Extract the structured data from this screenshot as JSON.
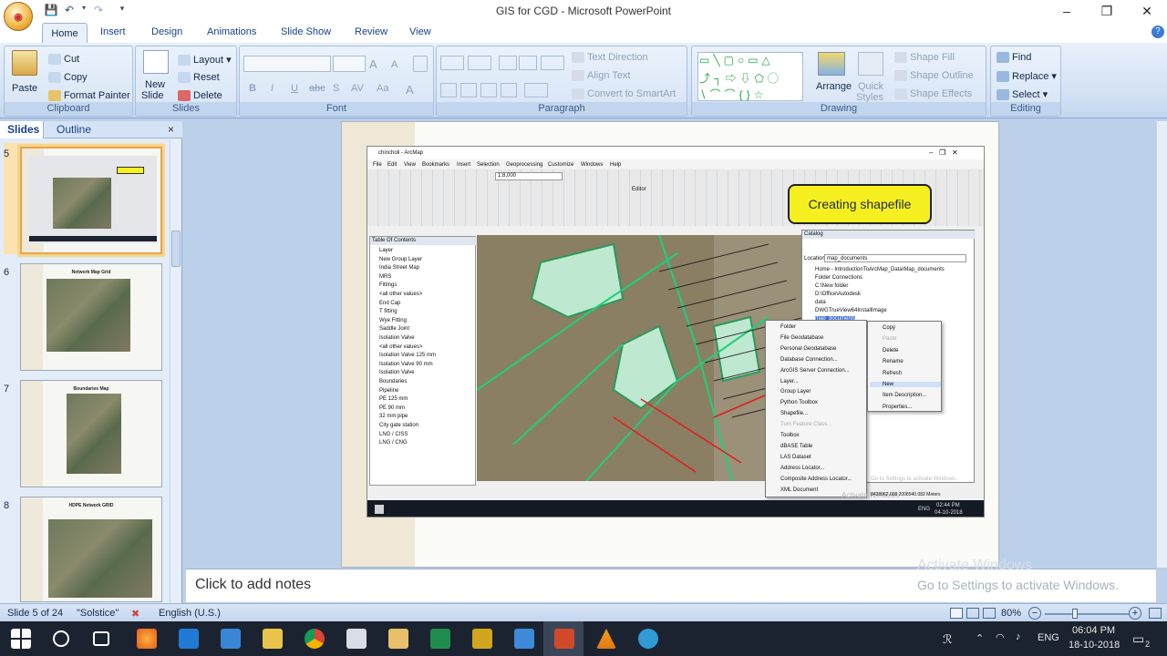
{
  "window": {
    "title": "GIS for CGD - Microsoft PowerPoint",
    "minimize_glyph": "–",
    "maximize_glyph": "❐",
    "close_glyph": "✕",
    "office_button_icon": "office-logo-icon"
  },
  "tabs": [
    "Home",
    "Insert",
    "Design",
    "Animations",
    "Slide Show",
    "Review",
    "View"
  ],
  "ribbon": {
    "clipboard": {
      "label": "Clipboard",
      "paste": "Paste",
      "cut": "Cut",
      "copy": "Copy",
      "format_painter": "Format Painter"
    },
    "slides": {
      "label": "Slides",
      "new_slide_line1": "New",
      "new_slide_line2": "Slide",
      "layout": "Layout",
      "reset": "Reset",
      "delete": "Delete"
    },
    "font": {
      "label": "Font",
      "bold": "B",
      "italic": "I",
      "underline": "U",
      "strike": "abc",
      "shadow": "S",
      "spacing": "AV",
      "case": "Aa",
      "color": "A",
      "grow": "A",
      "shrink": "A"
    },
    "paragraph": {
      "label": "Paragraph",
      "text_direction": "Text Direction",
      "align_text": "Align Text",
      "convert_smartart": "Convert to SmartArt"
    },
    "drawing": {
      "label": "Drawing",
      "arrange": "Arrange",
      "quick_styles_line1": "Quick",
      "quick_styles_line2": "Styles",
      "shape_fill": "Shape Fill",
      "shape_outline": "Shape Outline",
      "shape_effects": "Shape Effects"
    },
    "editing": {
      "label": "Editing",
      "find": "Find",
      "replace": "Replace",
      "select": "Select"
    }
  },
  "slides_pane": {
    "tab_slides": "Slides",
    "tab_outline": "Outline",
    "close_glyph": "×",
    "thumbnails": [
      {
        "number": "5",
        "title": "",
        "selected": true
      },
      {
        "number": "6",
        "title": "Network Map Grid",
        "selected": false
      },
      {
        "number": "7",
        "title": "Boundaries Map",
        "selected": false
      },
      {
        "number": "8",
        "title": "HDPE Network GRID",
        "selected": false
      }
    ]
  },
  "notes": {
    "placeholder": "Click to add notes"
  },
  "watermark": {
    "line1": "Activate Windows",
    "line2": "Go to Settings to activate Windows."
  },
  "status": {
    "slide_info": "Slide 5 of 24",
    "theme": "\"Solstice\"",
    "language": "English (U.S.)",
    "zoom": "80%"
  },
  "callout": {
    "text": "Creating shapefile"
  },
  "inner_arcmap": {
    "title": "chincholi - ArcMap",
    "menus": [
      "File",
      "Edit",
      "View",
      "Bookmarks",
      "Insert",
      "Selection",
      "Geoprocessing",
      "Customize",
      "Windows",
      "Help"
    ],
    "scale": "1:8,000",
    "editor_label": "Editor",
    "toc_title": "Table Of Contents",
    "toc_items": [
      "Layer",
      "New Group Layer",
      "India Street Map",
      "MRS",
      "Fittings",
      "<all other values>",
      "End Cap",
      "T fitting",
      "Wye Fitting",
      "Saddle Joint",
      "Isolation Valve",
      "<all other values>",
      "Isolation Valve 125 mm",
      "Isolation Valve 90 mm",
      "Isolation Valve",
      "Boundaries",
      "Pipeline",
      "PE 125 mm",
      "PE 90 mm",
      "32 mm pipe",
      "City gate station",
      "LNG / CISS",
      "LNG / CNG"
    ],
    "catalog_title": "Catalog",
    "catalog_location_label": "Location:",
    "catalog_location": "map_documents",
    "catalog_items": [
      "Home - IntroductionToArcMap_Data\\Map_documents",
      "Folder Connections",
      "C:\\New folder",
      "D:\\Office\\Autodesk",
      "data",
      "DWGTrueView64InstallImage",
      "map_documents"
    ],
    "new_menu": [
      "Folder",
      "File Geodatabase",
      "Personal Geodatabase",
      "Database Connection...",
      "ArcGIS Server Connection...",
      "Layer...",
      "Group Layer",
      "Python Toolbox",
      "Shapefile...",
      "Turn Feature Class...",
      "Toolbox",
      "dBASE Table",
      "LAS Dataset",
      "Address Locator...",
      "Composite Address Locator...",
      "XML Document"
    ],
    "context_menu": [
      "Copy",
      "Paste",
      "Delete",
      "Rename",
      "Refresh",
      "New",
      "Item Description...",
      "Properties..."
    ],
    "coords": "8438962.008 2008940.082 Meters",
    "clock_time": "02:44 PM",
    "clock_date": "04-10-2018",
    "lang": "ENG",
    "watermark1": "Activate Windows",
    "watermark2": "Go to Settings to activate Windows."
  },
  "taskbar": {
    "lang": "ENG",
    "time": "06:04 PM",
    "date": "18-10-2018",
    "notification_count": "2"
  }
}
